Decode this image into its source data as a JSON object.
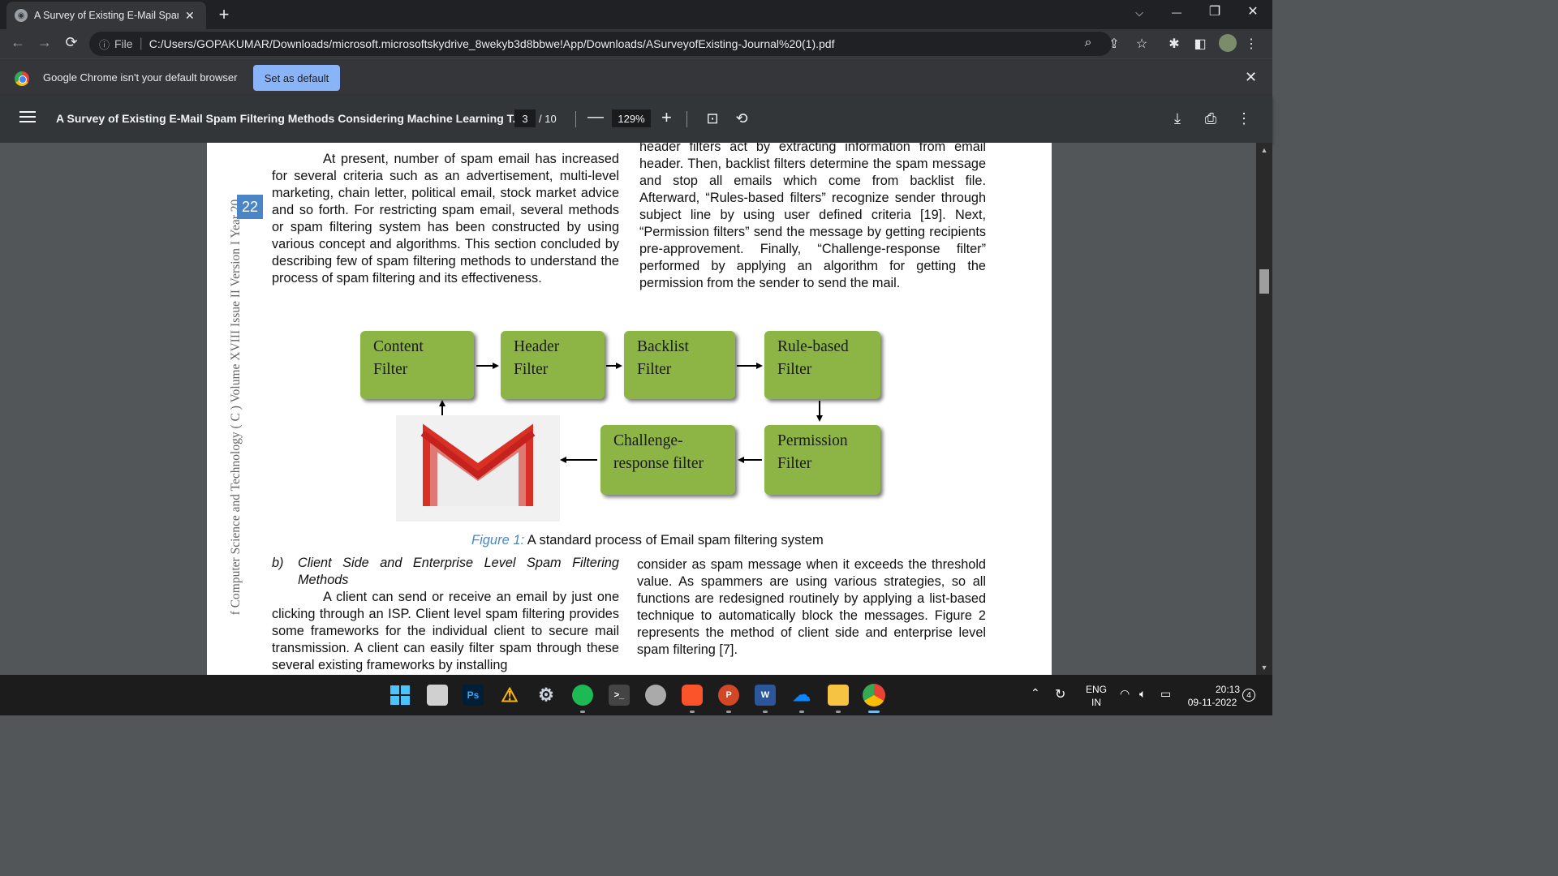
{
  "tab": {
    "title": "A Survey of Existing E-Mail Spam Filtering Methods",
    "close": "✕",
    "new_tab": "+"
  },
  "window": {
    "minimize": "—",
    "restore": "❐",
    "close": "✕",
    "dropdown": "⌵"
  },
  "address": {
    "back": "←",
    "forward": "→",
    "reload": "⟳",
    "info_icon": "ⓘ",
    "scheme_label": "File",
    "separator": "|",
    "url": "C:/Users/GOPAKUMAR/Downloads/microsoft.microsoftskydrive_8wekyb3d8bbwe!App/Downloads/ASurveyofExisting-Journal%20(1).pdf"
  },
  "infobar": {
    "message": "Google Chrome isn't your default browser",
    "button": "Set as default",
    "close": "✕"
  },
  "pdf_toolbar": {
    "title": "A Survey of Existing E-Mail Spam Filtering Methods Considering Machine Learning T...",
    "current_page": "3",
    "total_pages": "/ 10",
    "zoom": "129%",
    "zoom_out": "—",
    "zoom_in": "+"
  },
  "page": {
    "side_text": "f Computer Science and Technology ( C ) Volume XVIII Issue II Version I Year 20",
    "page_number": "22",
    "left_col_top": "At present, number of spam email has increased for several criteria such as an advertisement, multi-level marketing, chain letter, political email, stock market advice and so forth. For restricting spam email, several methods or spam filtering system has been constructed by using various concept and algorithms. This section concluded by describing few of spam filtering methods to understand the process of spam filtering and its effectiveness.",
    "right_col_top": "header filters act by extracting information from email header. Then, backlist filters determine the spam message and stop all emails which come from backlist file.  Afterward, “Rules-based filters” recognize sender through subject line by using user defined criteria [19]. Next, “Permission filters” send the message by getting recipients pre-approvement. Finally, “Challenge-response filter” performed by applying an algorithm for getting the permission from the sender to send the mail.",
    "figure": {
      "boxes": [
        {
          "line1": "Content",
          "line2": "Filter"
        },
        {
          "line1": "Header",
          "line2": "Filter"
        },
        {
          "line1": "Backlist",
          "line2": "Filter"
        },
        {
          "line1": "Rule-based",
          "line2": "Filter"
        },
        {
          "line1": "Challenge-",
          "line2": "response filter"
        },
        {
          "line1": "Permission",
          "line2": "Filter"
        }
      ],
      "caption_label": "Figure 1:",
      "caption_text": " A standard process of Email spam filtering system"
    },
    "subheading_marker": "b)",
    "subheading": "Client Side and Enterprise Level Spam Filtering Methods",
    "left_col_bottom": "A client can send or receive an email by just one clicking through an ISP. Client level spam filtering provides some frameworks for the individual client to secure mail transmission.  A client can easily filter spam through these several existing frameworks by installing",
    "right_col_bottom": "consider as spam message when it exceeds the threshold value. As spammers are using various strategies, so all functions are redesigned routinely by applying a list-based technique to automatically block the messages. Figure 2 represents the method of client side and enterprise level spam filtering [7]."
  },
  "taskbar": {
    "tray_lang_1": "ENG",
    "tray_lang_2": "IN",
    "time": "20:13",
    "date": "09-11-2022",
    "notifications": "4",
    "icons": [
      "windows-start-icon",
      "file-explorer-icon",
      "photoshop-icon",
      "warning-app-icon",
      "settings-icon",
      "spotify-icon",
      "terminal-icon",
      "network-drive-icon",
      "brave-icon",
      "powerpoint-icon",
      "word-icon",
      "onedrive-icon",
      "folder-icon",
      "chrome-icon"
    ]
  },
  "colors": {
    "accent": "#8ab4f8",
    "box_green": "#8cb546",
    "pagenum_blue": "#4a86c5",
    "gmail_red": "#d93025"
  }
}
